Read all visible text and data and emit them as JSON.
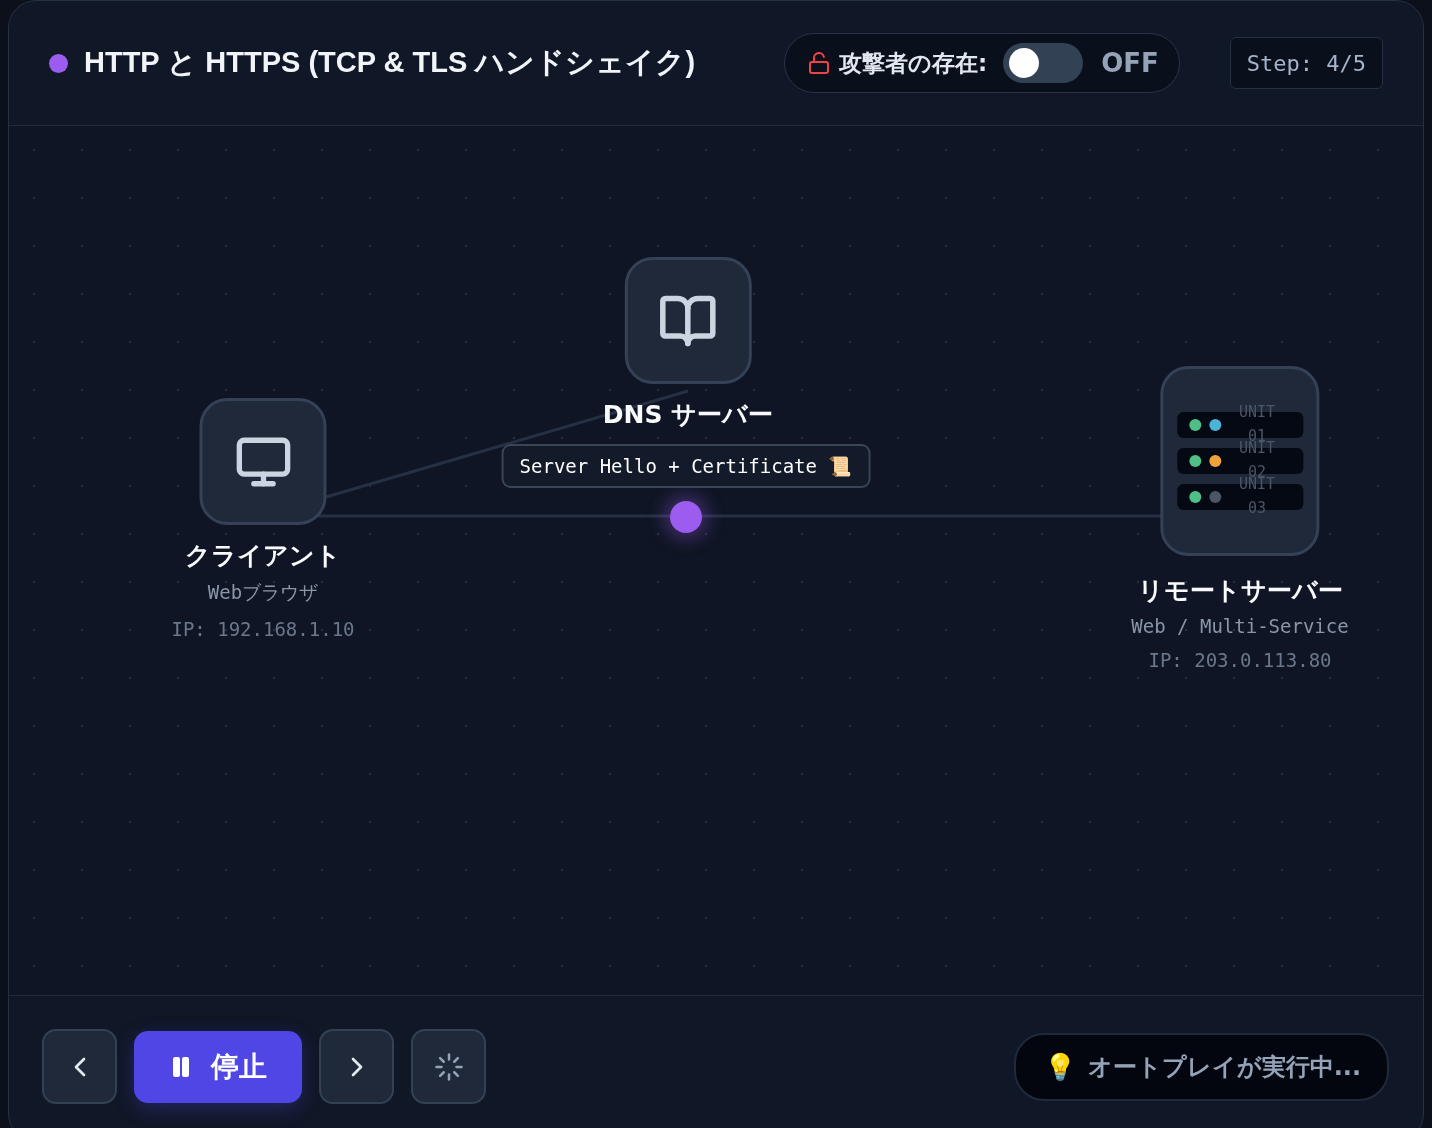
{
  "header": {
    "title": "HTTP と HTTPS (TCP & TLS ハンドシェイク)",
    "attacker": {
      "label": "攻撃者の存在:",
      "on": false,
      "state_text": "OFF"
    },
    "step": "Step: 4/5"
  },
  "nodes": [
    {
      "kind": "client",
      "name": "クライアント",
      "subtitle": "Webブラウザ",
      "ip": "IP: 192.168.1.10"
    },
    {
      "kind": "dns",
      "name": "DNS サーバー"
    },
    {
      "kind": "server",
      "name": "リモートサーバー",
      "subtitle": "Web / Multi-Service",
      "ip": "IP: 203.0.113.80",
      "units": [
        {
          "label_lines": [
            "UNIT",
            "01"
          ],
          "dots": [
            {
              "color": "#4fbf87"
            },
            {
              "color": "#4ab4d8"
            }
          ]
        },
        {
          "label_lines": [
            "UNIT",
            "02"
          ],
          "dots": [
            {
              "color": "#4fbf87"
            },
            {
              "color": "#f0a23a"
            }
          ]
        },
        {
          "label_lines": [
            "UNIT",
            "03"
          ],
          "dots": [
            {
              "color": "#4fbf87"
            },
            {
              "color": "#4b5563"
            }
          ]
        }
      ]
    }
  ],
  "packet": {
    "label": "Server Hello + Certificate 📜"
  },
  "controls": {
    "pause_label": "停止",
    "playing": true
  },
  "hint": {
    "icon": "💡",
    "text": "オートプレイが実行中..."
  }
}
